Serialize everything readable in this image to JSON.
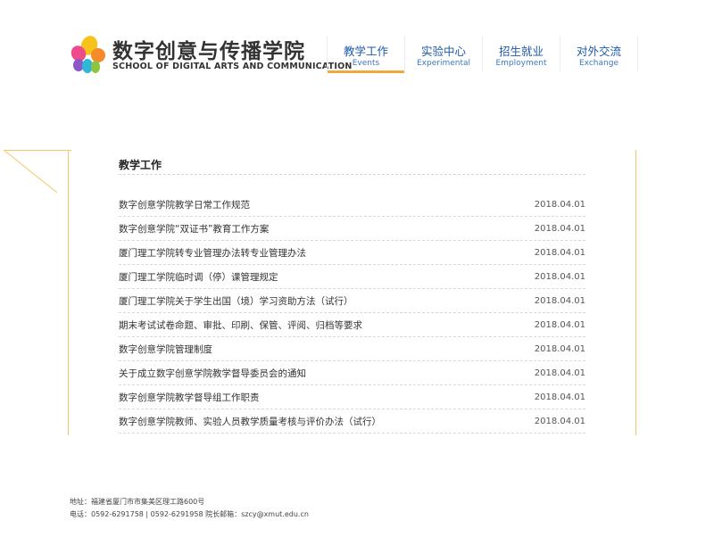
{
  "header": {
    "logo_cn": "数字创意与传播学院",
    "logo_en": "SCHOOL OF DIGITAL ARTS AND COMMUNICATION",
    "nav": [
      {
        "cn": "教学工作",
        "en": "Events"
      },
      {
        "cn": "实验中心",
        "en": "Experimental"
      },
      {
        "cn": "招生就业",
        "en": "Employment"
      },
      {
        "cn": "对外交流",
        "en": "Exchange"
      }
    ],
    "active_index": 0
  },
  "main": {
    "section_title": "教学工作",
    "items": [
      {
        "title": "数字创意学院教学日常工作规范",
        "date": "2018.04.01"
      },
      {
        "title": "数字创意学院“双证书”教育工作方案",
        "date": "2018.04.01"
      },
      {
        "title": "厦门理工学院转专业管理办法转专业管理办法",
        "date": "2018.04.01"
      },
      {
        "title": "厦门理工学院临时调（停）课管理规定",
        "date": "2018.04.01"
      },
      {
        "title": "厦门理工学院关于学生出国（境）学习资助方法（试行）",
        "date": "2018.04.01"
      },
      {
        "title": "期末考试试卷命题、审批、印刷、保管、评阅、归档等要求",
        "date": "2018.04.01"
      },
      {
        "title": "数字创意学院管理制度",
        "date": "2018.04.01"
      },
      {
        "title": "关于成立数字创意学院教学督导委员会的通知",
        "date": "2018.04.01"
      },
      {
        "title": "数字创意学院教学督导组工作职责",
        "date": "2018.04.01"
      },
      {
        "title": "数字创意学院教师、实验人员教学质量考核与评价办法（试行）",
        "date": "2018.04.01"
      }
    ]
  },
  "footer": {
    "address": "地址：福建省厦门市市集美区理工路600号",
    "contact": "电话：0592-6291758 | 0592-6291958 院长邮箱：szcy@xmut.edu.cn"
  },
  "colors": {
    "nav_text": "#1e5aa8",
    "accent": "#f2a93b",
    "panel_line": "#f4c56b"
  }
}
